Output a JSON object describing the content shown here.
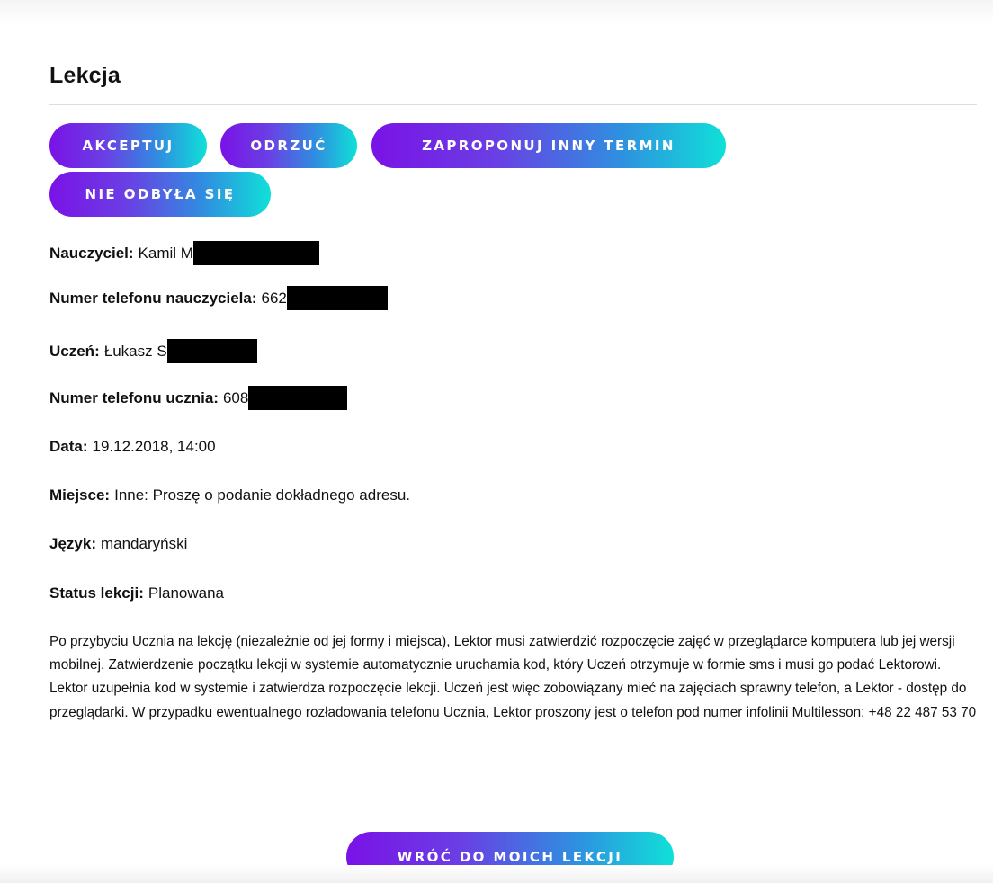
{
  "lesson": {
    "title": "Lekcja",
    "actions": {
      "accept": "AKCEPTUJ",
      "reject": "ODRZUĆ",
      "propose": "ZAPROPONUJ INNY TERMIN",
      "not_held": "NIE ODBYŁA SIĘ"
    },
    "fields": {
      "teacher_label": "Nauczyciel:",
      "teacher_value": "Kamil M",
      "teacher_phone_label": "Numer telefonu nauczyciela:",
      "teacher_phone_value": "662",
      "student_label": "Uczeń:",
      "student_value": "Łukasz S",
      "student_phone_label": "Numer telefonu ucznia:",
      "student_phone_value": "608",
      "date_label": "Data:",
      "date_value": "19.12.2018, 14:00",
      "place_label": "Miejsce:",
      "place_value": "Inne: Proszę o podanie dokładnego adresu.",
      "language_label": "Język:",
      "language_value": "mandaryński",
      "status_label": "Status lekcji:",
      "status_value": "Planowana"
    },
    "note": "Po przybyciu Ucznia na lekcję (niezależnie od jej formy i miejsca), Lektor musi zatwierdzić rozpoczęcie zajęć w przeglądarce komputera lub jej wersji mobilnej. Zatwierdzenie początku lekcji w systemie automatycznie uruchamia kod, który Uczeń otrzymuje w formie sms i musi go podać Lektorowi. Lektor uzupełnia kod w systemie i zatwierdza rozpoczęcie lekcji. Uczeń jest więc zobowiązany mieć na zajęciach sprawny telefon, a Lektor - dostęp do przeglądarki. W przypadku ewentualnego rozładowania telefonu Ucznia, Lektor proszony jest o telefon pod numer infolinii Multilesson: +48 22 487 53 70",
    "back_button": "WRÓĆ DO MOICH LEKCJI"
  },
  "colors": {
    "gradient_start": "#7a12e6",
    "gradient_end": "#10e0d8",
    "text": "#111111",
    "redaction": "#000000"
  }
}
